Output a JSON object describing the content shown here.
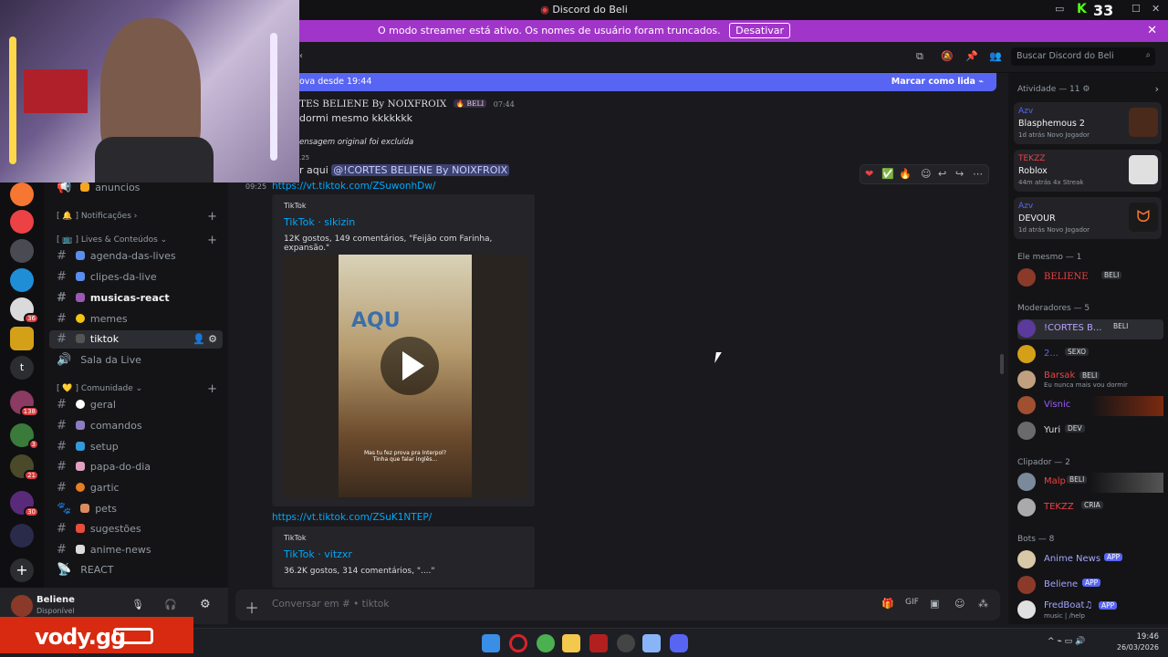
{
  "window": {
    "title": "Discord do Beli",
    "counter": "33"
  },
  "streamer_banner": {
    "text": "O modo streamer está ativo. Os nomes de usuário foram truncados.",
    "button": "Desativar"
  },
  "header": {
    "search_placeholder": "Buscar Discord do Beli"
  },
  "new_bar": {
    "left": "ova desde 19:44",
    "right": "Marcar como lida"
  },
  "channels": {
    "cat_notificacoes": "Notificações",
    "cat_lives": "Lives & Conteúdos",
    "cat_comunidade": "Comunidade",
    "items": {
      "anuncios": "anuncios",
      "agenda": "agenda-das-lives",
      "clipes": "clipes-da-live",
      "musicas": "musicas-react",
      "memes": "memes",
      "tiktok": "tiktok",
      "sala": "Sala da Live",
      "geral": "geral",
      "comandos": "comandos",
      "setup": "setup",
      "papa": "papa-do-dia",
      "gartic": "gartic",
      "pets": "pets",
      "sugestoes": "sugestões",
      "anime": "anime-news",
      "react": "REACT"
    }
  },
  "user_panel": {
    "name": "Beliene",
    "status": "Disponível"
  },
  "messages": {
    "author": "TES BELIENE By NOIXFROIX",
    "author_tag": "BELI",
    "time1": "07:44",
    "text1": "dormi mesmo kkkkkkk",
    "deleted": "ensagem original foi excluída",
    "time_small": ".25",
    "time2": "09:25",
    "text2_prefix": "r aqui",
    "mention": "@!CORTES BELIENE By NOIXFROIX",
    "link1": "https://vt.tiktok.com/ZSuwonhDw/",
    "embed1": {
      "provider": "TikTok",
      "title": "TikTok · sikizin",
      "desc": "12K gostos, 149 comentários, \"Feijão com Farinha, expansão.\"",
      "caption": "Mas tu fez prova pra Interpol?\nTinha que falar inglês..."
    },
    "link2": "https://vt.tiktok.com/ZSuK1NTEP/",
    "embed2": {
      "provider": "TikTok",
      "title": "TikTok · vitzxr",
      "desc": "36.2K gostos, 314 comentários, \"....\""
    }
  },
  "composer": {
    "placeholder": "Conversar em #",
    "channel": "tiktok"
  },
  "activity": {
    "header": "Atividade — 11",
    "cards": [
      {
        "name": "Azv",
        "game": "Blasphemous 2",
        "meta": "1d atrás   Novo Jogador"
      },
      {
        "name": "TEKZZ",
        "game": "Roblox",
        "meta": "44m atrás   4x Streak"
      },
      {
        "name": "Azv",
        "game": "DEVOUR",
        "meta": "1d atrás   Novo Jogador"
      }
    ]
  },
  "members": {
    "ele": {
      "title": "Ele mesmo — 1",
      "list": [
        {
          "name": "BELIENE",
          "tag": "BELI"
        }
      ]
    },
    "mods": {
      "title": "Moderadores — 5",
      "list": [
        {
          "name": "!CORTES B...",
          "tag": "BELI"
        },
        {
          "name": "2...",
          "tag": "SEXO"
        },
        {
          "name": "Barsak",
          "tag": "BELI",
          "sub": "Eu nunca mais vou dormir"
        },
        {
          "name": "Visnic",
          "tag": ""
        },
        {
          "name": "Yuri",
          "tag": "DEV"
        }
      ]
    },
    "clip": {
      "title": "Clipador — 2",
      "list": [
        {
          "name": "Malp",
          "tag": "BELI"
        },
        {
          "name": "TEKZZ",
          "tag": "CRIA"
        }
      ]
    },
    "bots": {
      "title": "Bots — 8",
      "list": [
        {
          "name": "Anime News",
          "tag": "APP"
        },
        {
          "name": "Beliene",
          "tag": "APP"
        },
        {
          "name": "FredBoat♫",
          "tag": "APP",
          "sub": "music | /help"
        }
      ]
    }
  },
  "taskbar": {
    "time": "19:46",
    "date": "26/03/2026"
  },
  "overlay": {
    "brand": "vody.gg"
  },
  "guild_badges": {
    "b1": "36",
    "b2": "138",
    "b3": "3",
    "b4": "21",
    "b5": "30"
  },
  "colors": {
    "accent": "#5865f2",
    "streamer": "#a235c9",
    "link": "#00a8fc",
    "mod_name": "#9b59ff",
    "bot_name": "#a3a6ff"
  }
}
